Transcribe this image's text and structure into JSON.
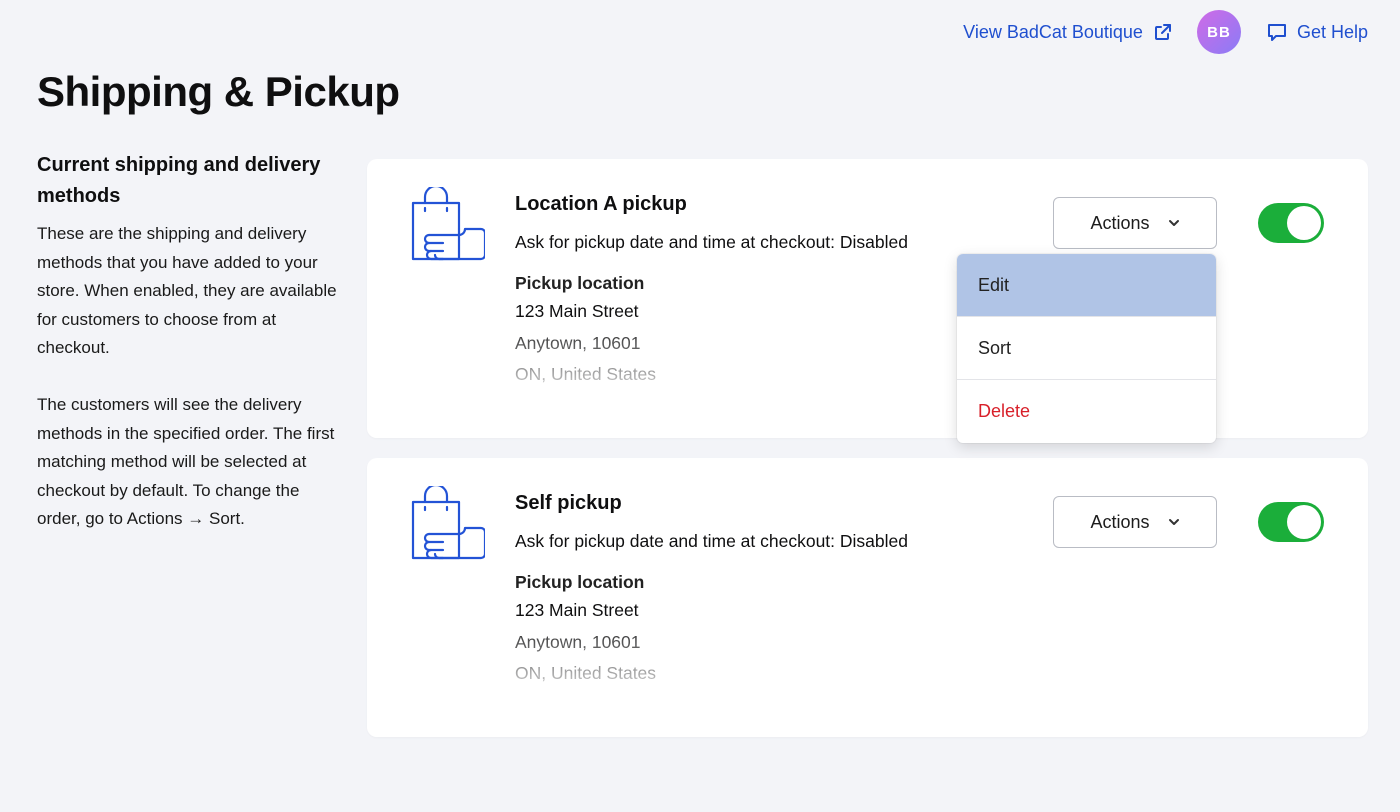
{
  "header": {
    "store_link": "View BadCat Boutique",
    "avatar_initials": "BB",
    "help_link": "Get Help"
  },
  "page": {
    "title": "Shipping & Pickup"
  },
  "side": {
    "heading": "Current shipping and delivery methods",
    "para1": "These are the shipping and delivery methods that you have added to your store. When enabled, they are available for customers to choose from at checkout.",
    "para2": "The customers will see the delivery methods in the specified order. The first matching method will be selected at checkout by default. To change the order, go to Actions → Sort."
  },
  "methods": [
    {
      "title": "Location A pickup",
      "desc": "Ask for pickup date and time at checkout: Disabled",
      "location_label": "Pickup location",
      "address1": "123 Main Street",
      "address2": "Anytown, 10601",
      "address3": "ON, United States",
      "actions_label": "Actions",
      "enabled": true
    },
    {
      "title": "Self pickup",
      "desc": "Ask for pickup date and time at checkout: Disabled",
      "location_label": "Pickup location",
      "address1": "123 Main Street",
      "address2": "Anytown, 10601",
      "address3": "ON, United States",
      "actions_label": "Actions",
      "enabled": true
    }
  ],
  "dropdown": {
    "items": [
      "Edit",
      "Sort",
      "Delete"
    ],
    "highlighted": "Edit"
  },
  "colors": {
    "accent": "#1f4fcf",
    "toggle_on": "#1bae3a",
    "danger": "#d8202a",
    "highlight": "#b0c4e6",
    "background": "#f3f4f8"
  },
  "icons": {
    "store_link": "external-link-icon",
    "help": "chat-bubble-icon",
    "method": "shopping-bag-hand-icon",
    "actions": "chevron-down-icon"
  }
}
